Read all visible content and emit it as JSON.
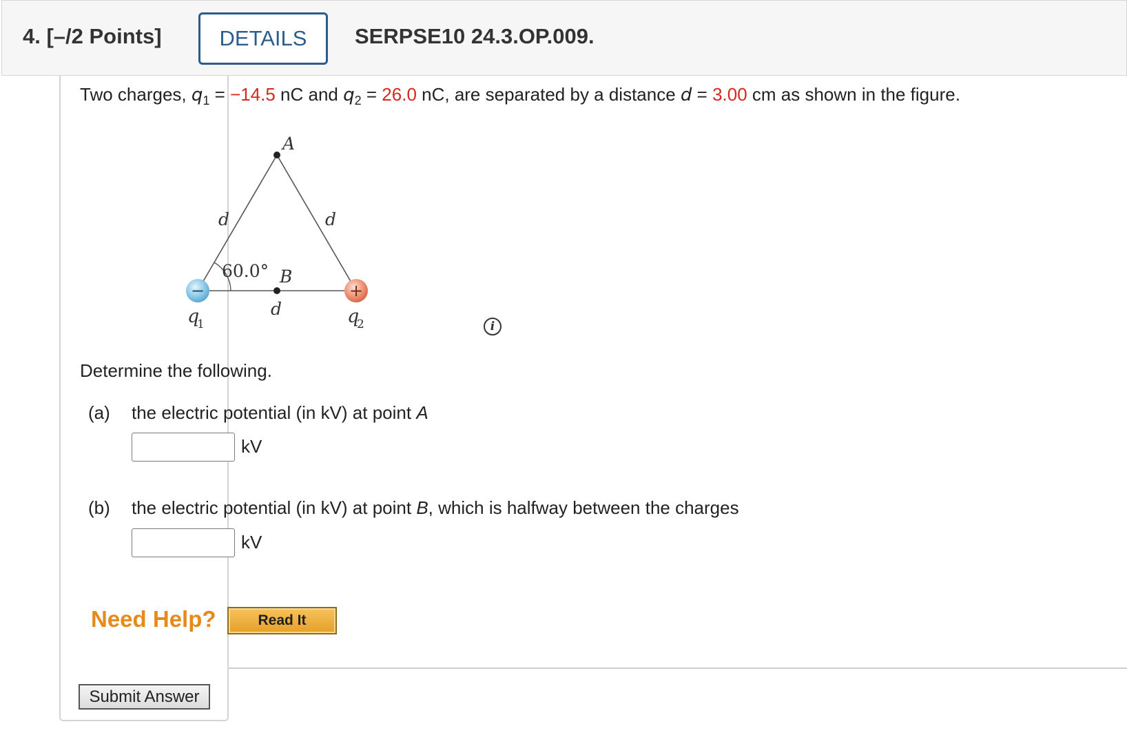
{
  "header": {
    "question_label": "4.  [–/2 Points]",
    "details_button": "DETAILS",
    "question_code": "SERPSE10 24.3.OP.009."
  },
  "prompt": {
    "lead": "Two charges, ",
    "q1_symbol": "q",
    "q1_sub": "1",
    "eq1": " = ",
    "q1_value": "−14.5",
    "q1_unit_and": " nC and ",
    "q2_symbol": "q",
    "q2_sub": "2",
    "eq2": " = ",
    "q2_value": "26.0",
    "q2_unit_rest": " nC, are separated by a distance ",
    "d_symbol": "d",
    "eq3": " = ",
    "d_value": "3.00",
    "tail": " cm as shown in the figure."
  },
  "figure": {
    "label_A": "A",
    "label_B": "B",
    "label_d_left": "d",
    "label_d_right": "d",
    "label_d_bottom": "d",
    "angle": "60.0°",
    "q1_label": "q",
    "q1_sub": "1",
    "q2_label": "q",
    "q2_sub": "2",
    "minus_sign": "−",
    "plus_sign": "+"
  },
  "info_icon": "i",
  "determine": "Determine the following.",
  "parts": [
    {
      "label": "(a)",
      "text": "the electric potential (in kV) at point ",
      "point": "A",
      "suffix": "",
      "input_value": "",
      "unit": "kV"
    },
    {
      "label": "(b)",
      "text": "the electric potential (in kV) at point ",
      "point": "B",
      "suffix": ", which is halfway between the charges",
      "input_value": "",
      "unit": "kV"
    }
  ],
  "help": {
    "need_help": "Need Help?",
    "read_it": "Read It"
  },
  "submit": "Submit Answer",
  "colors": {
    "given_value_red": "#d6281f",
    "details_blue": "#2b5d8c",
    "need_help_orange": "#e8891c"
  }
}
